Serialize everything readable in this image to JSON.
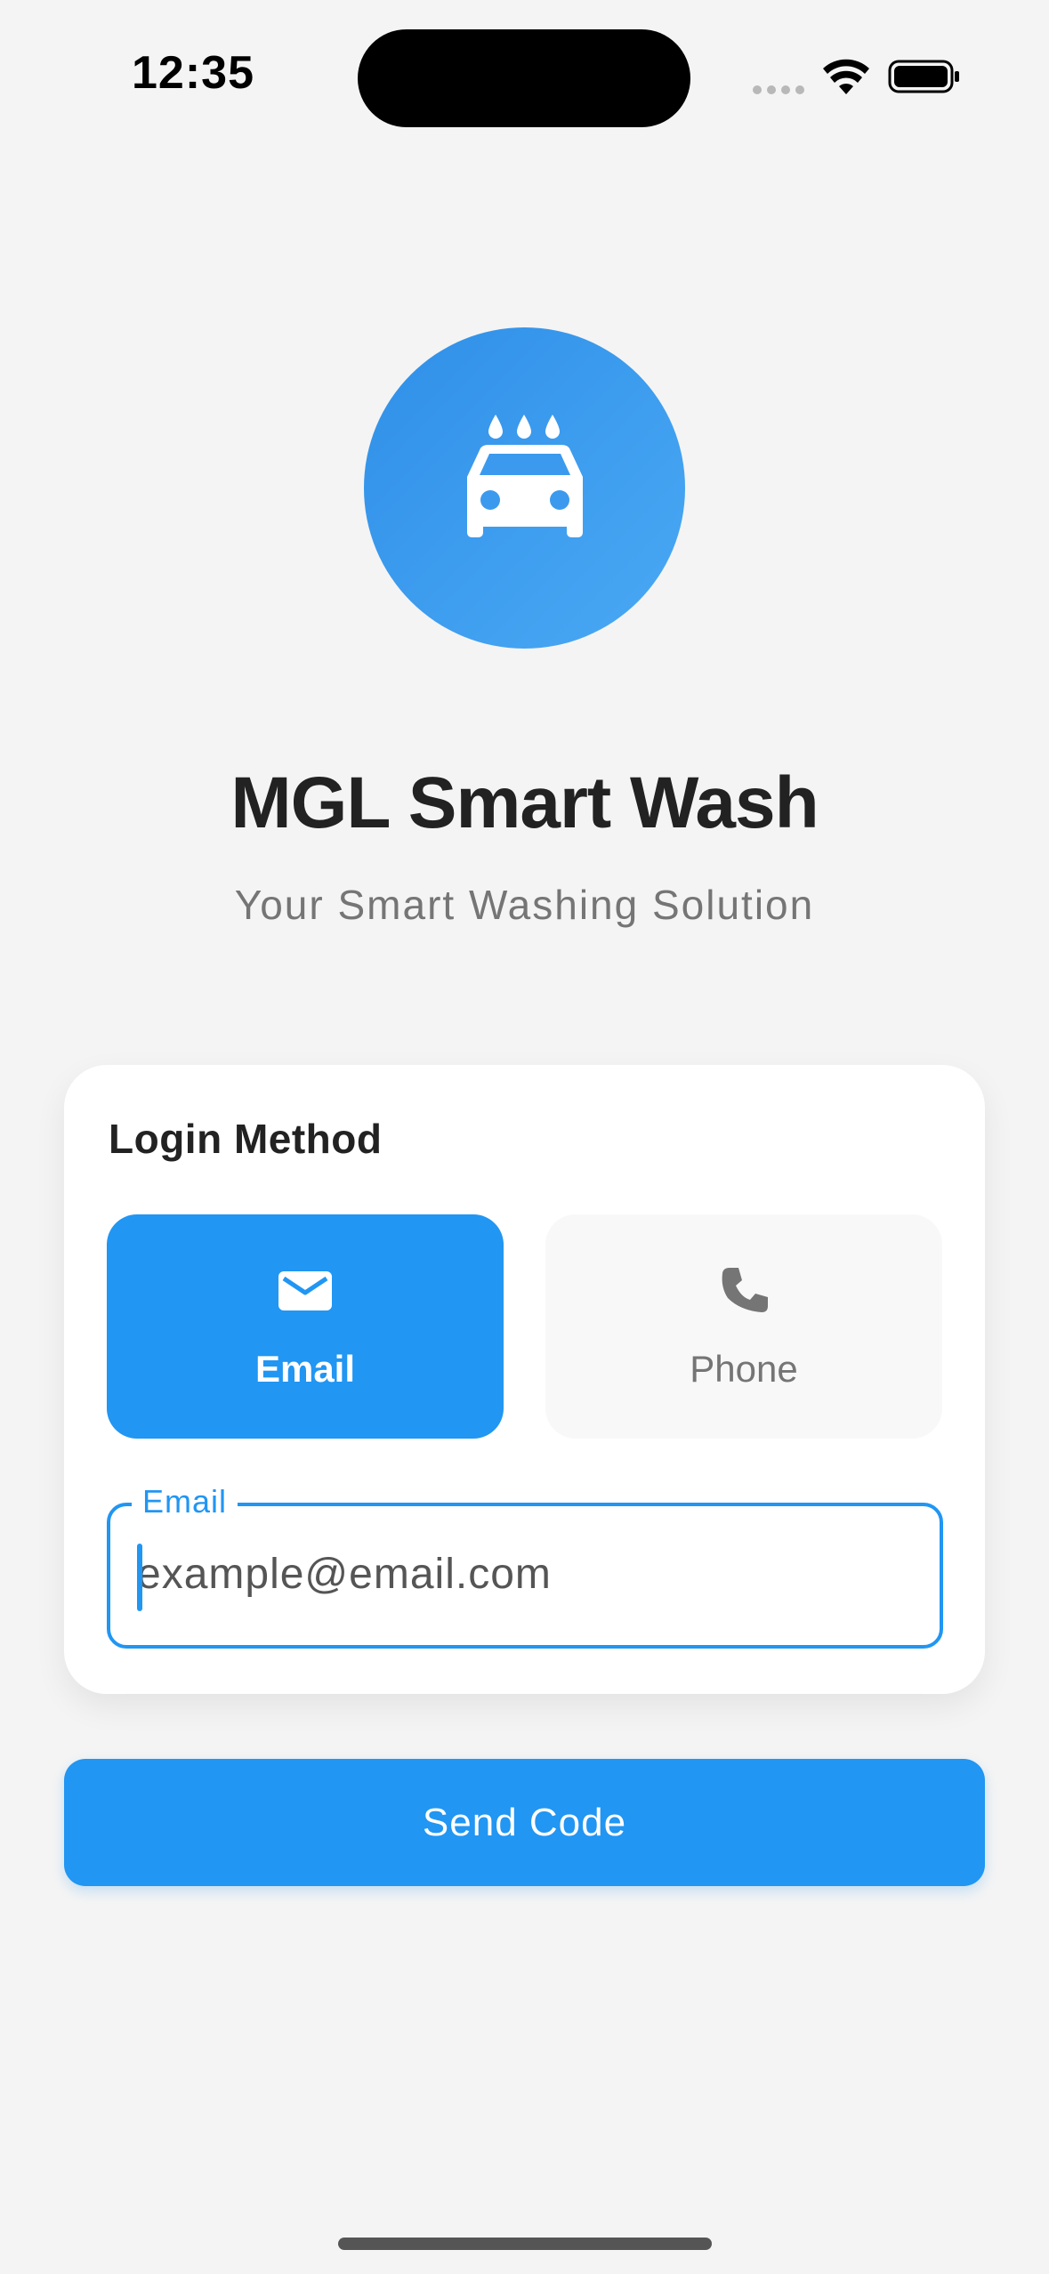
{
  "status_bar": {
    "time": "12:35"
  },
  "app": {
    "logo_icon": "car-wash-icon",
    "title": "MGL Smart Wash",
    "subtitle": "Your Smart Washing Solution"
  },
  "login_card": {
    "heading": "Login Method",
    "methods": [
      {
        "label": "Email",
        "icon": "mail-icon",
        "selected": true
      },
      {
        "label": "Phone",
        "icon": "phone-icon",
        "selected": false
      }
    ],
    "email_field": {
      "label": "Email",
      "value": "",
      "placeholder": "example@email.com"
    }
  },
  "send_button": {
    "label": "Send Code"
  },
  "colors": {
    "primary": "#2196f3",
    "background": "#f4f4f4",
    "card": "#ffffff",
    "title_text": "#222222",
    "muted_text": "#757575"
  }
}
